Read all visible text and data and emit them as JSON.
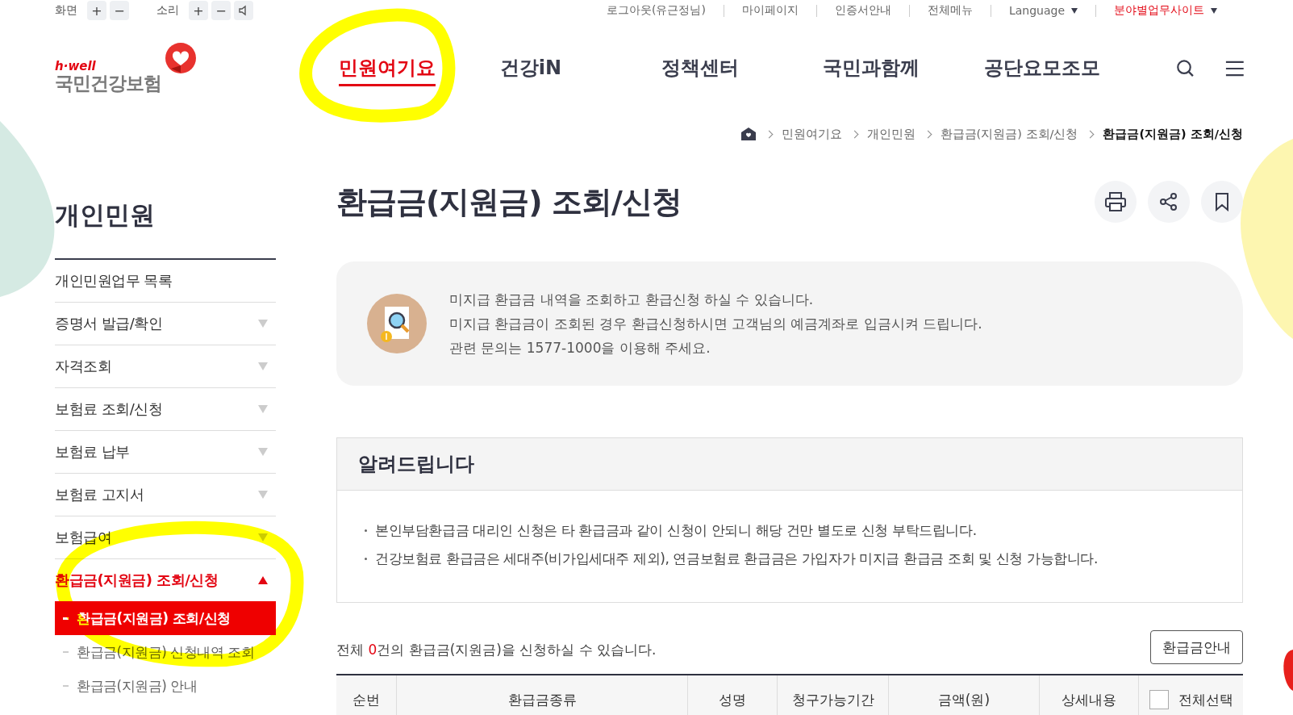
{
  "utility": {
    "screen_label": "화면",
    "screen_keys": [
      "+",
      "−"
    ],
    "sound_label": "소리",
    "sound_keys": [
      "+",
      "−"
    ]
  },
  "top_links": [
    {
      "label": "로그아웃(유근정님)",
      "dropdown": false,
      "accent": false
    },
    {
      "label": "마이페이지",
      "dropdown": false,
      "accent": false
    },
    {
      "label": "인증서안내",
      "dropdown": false,
      "accent": false
    },
    {
      "label": "전체메뉴",
      "dropdown": false,
      "accent": false
    },
    {
      "label": "Language",
      "dropdown": true,
      "accent": false
    },
    {
      "label": "분야별업무사이트",
      "dropdown": true,
      "accent": true
    }
  ],
  "logo": {
    "tagline": "h·well",
    "name": "국민건강보험"
  },
  "nav": [
    {
      "label": "민원여기요",
      "selected": true
    },
    {
      "label": "건강iN",
      "selected": false
    },
    {
      "label": "정책센터",
      "selected": false
    },
    {
      "label": "국민과함께",
      "selected": false
    },
    {
      "label": "공단요모조모",
      "selected": false
    }
  ],
  "breadcrumb": [
    {
      "label": "민원여기요",
      "current": false
    },
    {
      "label": "개인민원",
      "current": false
    },
    {
      "label": "환급금(지원금) 조회/신청",
      "current": false
    },
    {
      "label": "환급금(지원금) 조회/신청",
      "current": true
    }
  ],
  "sidebar": {
    "title": "개인민원",
    "items": [
      {
        "label": "개인민원업무 목록",
        "kind": "link",
        "selected": false
      },
      {
        "label": "증명서 발급/확인",
        "kind": "group",
        "expanded": false,
        "selected": false
      },
      {
        "label": "자격조회",
        "kind": "group",
        "expanded": false,
        "selected": false
      },
      {
        "label": "보험료 조회/신청",
        "kind": "group",
        "expanded": false,
        "selected": false
      },
      {
        "label": "보험료 납부",
        "kind": "group",
        "expanded": false,
        "selected": false
      },
      {
        "label": "보험료 고지서",
        "kind": "group",
        "expanded": false,
        "selected": false
      },
      {
        "label": "보험급여",
        "kind": "group",
        "expanded": false,
        "selected": false
      },
      {
        "label": "환급금(지원금) 조회/신청",
        "kind": "group",
        "expanded": true,
        "selected": true,
        "children": [
          {
            "label": "환급금(지원금) 조회/신청",
            "selected": true
          },
          {
            "label": "환급금(지원금) 신청내역 조회",
            "selected": false
          },
          {
            "label": "환급금(지원금) 안내",
            "selected": false
          }
        ]
      }
    ]
  },
  "page_title": "환급금(지원금) 조회/신청",
  "info_lines": [
    "미지급 환급금 내역을 조회하고 환급신청 하실 수 있습니다.",
    "미지급 환급금이 조회된 경우 환급신청하시면 고객님의 예금계좌로 입금시켜 드립니다.",
    "관련 문의는 1577-1000을 이용해 주세요."
  ],
  "notice": {
    "title": "알려드립니다",
    "items": [
      "본인부담환급금 대리인 신청은 타 환급금과 같이 신청이 안되니 해당 건만 별도로 신청 부탁드립니다.",
      "건강보험료 환급금은 세대주(비가입세대주 제외), 연금보험료 환급금은 가입자가 미지급 환급금 조회 및 신청 가능합니다."
    ]
  },
  "count": {
    "prefix": "전체 ",
    "number": "0",
    "suffix": "건의 환급금(지원금)을 신청하실 수 있습니다."
  },
  "guide_button": "환급금안내",
  "table": {
    "columns": [
      "순번",
      "환급금종류",
      "성명",
      "청구가능기간",
      "금액(원)",
      "상세내용"
    ],
    "select_all": {
      "label": "전체선택",
      "checked": false
    }
  }
}
